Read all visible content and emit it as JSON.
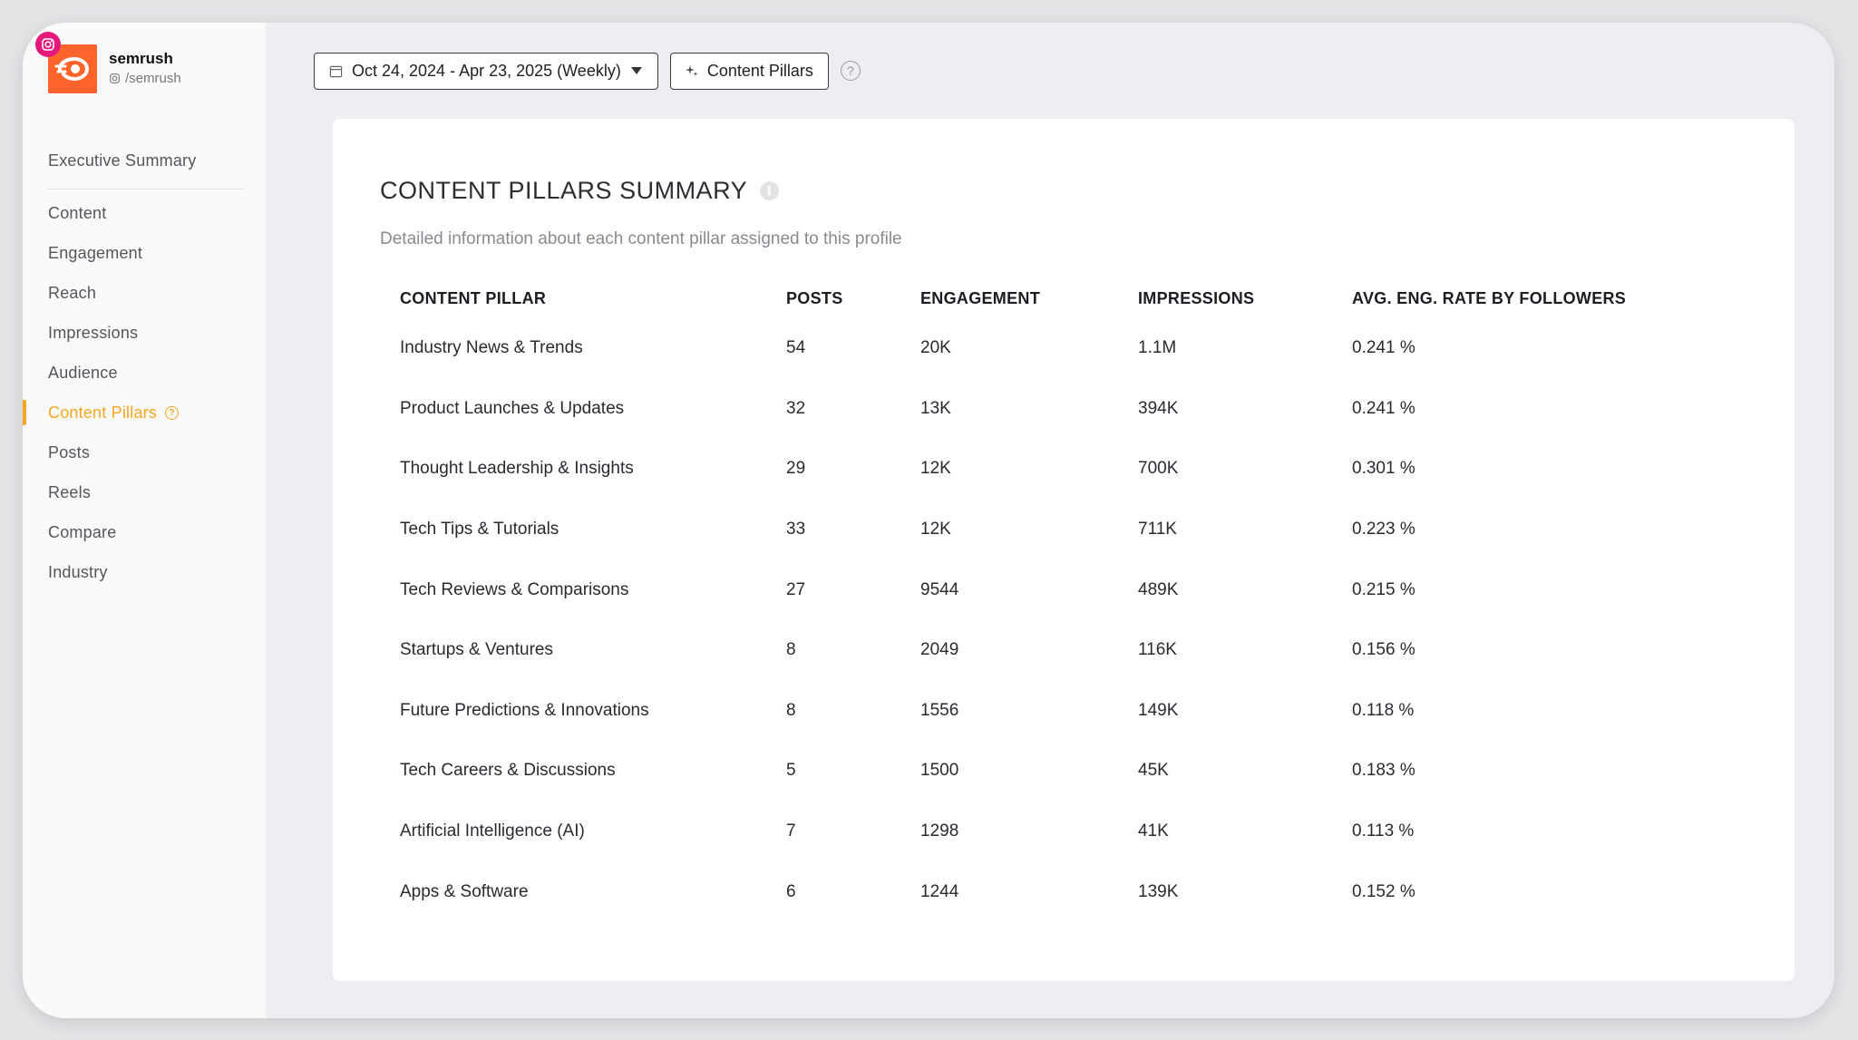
{
  "profile": {
    "name": "semrush",
    "handle": "/semrush",
    "platform_icon": "instagram-icon",
    "brand_color": "#ff642d"
  },
  "nav": {
    "items": [
      {
        "label": "Executive Summary"
      },
      {
        "label": "Content"
      },
      {
        "label": "Engagement"
      },
      {
        "label": "Reach"
      },
      {
        "label": "Impressions"
      },
      {
        "label": "Audience"
      },
      {
        "label": "Content Pillars"
      },
      {
        "label": "Posts"
      },
      {
        "label": "Reels"
      },
      {
        "label": "Compare"
      },
      {
        "label": "Industry"
      }
    ],
    "active": "Content Pillars",
    "accent_color": "#f5a623"
  },
  "toolbar": {
    "date_range": "Oct 24, 2024 - Apr 23, 2025 (Weekly)",
    "content_pillars_label": "Content Pillars",
    "help_glyph": "?"
  },
  "summary": {
    "title": "CONTENT PILLARS SUMMARY",
    "subtitle": "Detailed information about each content pillar assigned to this profile",
    "columns": [
      "CONTENT PILLAR",
      "POSTS",
      "ENGAGEMENT",
      "IMPRESSIONS",
      "AVG. ENG. RATE BY FOLLOWERS"
    ],
    "rows": [
      [
        "Industry News & Trends",
        "54",
        "20K",
        "1.1M",
        "0.241 %"
      ],
      [
        "Product Launches & Updates",
        "32",
        "13K",
        "394K",
        "0.241 %"
      ],
      [
        "Thought Leadership & Insights",
        "29",
        "12K",
        "700K",
        "0.301 %"
      ],
      [
        "Tech Tips & Tutorials",
        "33",
        "12K",
        "711K",
        "0.223 %"
      ],
      [
        "Tech Reviews & Comparisons",
        "27",
        "9544",
        "489K",
        "0.215 %"
      ],
      [
        "Startups & Ventures",
        "8",
        "2049",
        "116K",
        "0.156 %"
      ],
      [
        "Future Predictions & Innovations",
        "8",
        "1556",
        "149K",
        "0.118 %"
      ],
      [
        "Tech Careers & Discussions",
        "5",
        "1500",
        "45K",
        "0.183 %"
      ],
      [
        "Artificial Intelligence (AI)",
        "7",
        "1298",
        "41K",
        "0.113 %"
      ],
      [
        "Apps & Software",
        "6",
        "1244",
        "139K",
        "0.152 %"
      ]
    ]
  }
}
